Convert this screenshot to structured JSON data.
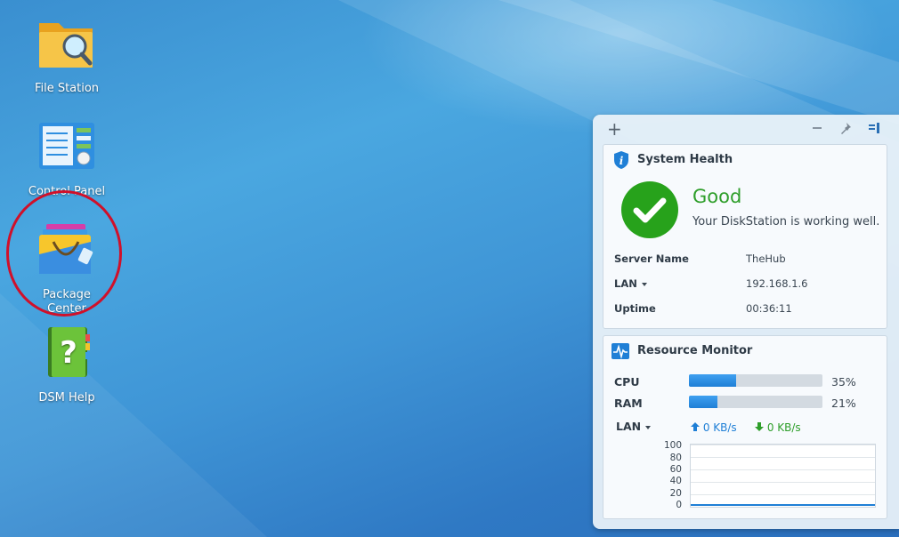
{
  "desktop": {
    "icons": [
      {
        "label": "File Station",
        "icon": "file-station-icon"
      },
      {
        "label": "Control Panel",
        "icon": "control-panel-icon"
      },
      {
        "label": "Package\nCenter",
        "icon": "package-center-icon"
      },
      {
        "label": "DSM Help",
        "icon": "dsm-help-icon"
      }
    ]
  },
  "widget_panel": {
    "toolbar": {
      "add": "+",
      "minimize": "minus-icon",
      "pin": "pin-icon",
      "dock": "dock-icon"
    },
    "system_health": {
      "title": "System Health",
      "status": "Good",
      "status_text": "Your DiskStation is working well.",
      "status_color": "#2e9e2a",
      "rows": [
        {
          "key": "Server Name",
          "value": "TheHub"
        },
        {
          "key": "LAN",
          "value": "192.168.1.6",
          "dropdown": true
        },
        {
          "key": "Uptime",
          "value": "00:36:11"
        }
      ]
    },
    "resource_monitor": {
      "title": "Resource Monitor",
      "cpu": {
        "label": "CPU",
        "percent": 35,
        "text": "35%"
      },
      "ram": {
        "label": "RAM",
        "percent": 21,
        "text": "21%"
      },
      "lan": {
        "label": "LAN",
        "upload": "0 KB/s",
        "download": "0 KB/s"
      },
      "graph": {
        "yticks": [
          "100",
          "80",
          "60",
          "40",
          "20",
          "0"
        ]
      }
    }
  }
}
